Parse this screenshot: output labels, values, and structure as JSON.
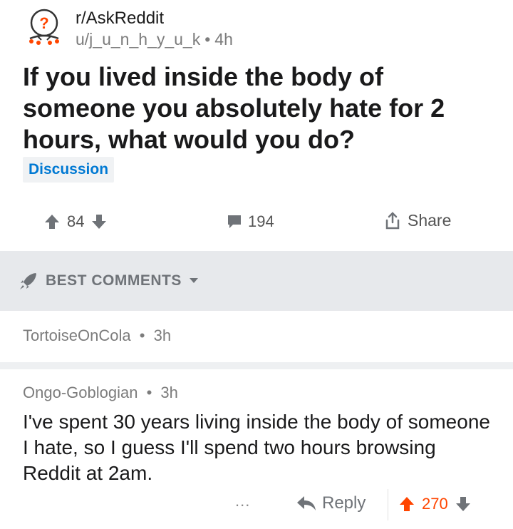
{
  "post": {
    "subreddit": "r/AskReddit",
    "author": "u/j_u_n_h_y_u_k",
    "age": "4h",
    "meta_separator": "•",
    "title": "If you lived inside the body of someone you absolutely hate for 2 hours, what would you do?",
    "flair": "Discussion",
    "score": "84",
    "comments_count": "194",
    "share_label": "Share"
  },
  "sort": {
    "label": "BEST COMMENTS"
  },
  "comments": [
    {
      "author": "TortoiseOnCola",
      "age": "3h",
      "separator": "•"
    },
    {
      "author": "Ongo-Goblogian",
      "age": "3h",
      "separator": "•",
      "body": "I've spent 30 years living inside the body of someone I hate, so I guess I'll spend two hours browsing Reddit at 2am.",
      "more": "...",
      "reply_label": "Reply",
      "score": "270"
    }
  ],
  "colors": {
    "upvote_active": "#ff4500",
    "flair_text": "#0079d3",
    "muted": "#7c7c7c",
    "sort_bar_bg": "#e7e9ec"
  }
}
